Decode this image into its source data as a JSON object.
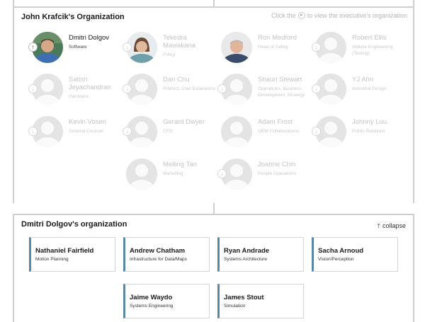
{
  "exec_panel": {
    "title": "John Krafcik's Organization",
    "hint_before": "Click the",
    "hint_after": "to view the executive's organization"
  },
  "executives": [
    {
      "name": "Dmitri Dolgov",
      "title": "Software",
      "active": true,
      "photo": "man-blue-shirt"
    },
    {
      "name": "Tekedra Mawakana",
      "title": "Policy",
      "active": false,
      "photo": "woman"
    },
    {
      "name": "Ron Medford",
      "title": "Head of Safety",
      "active": false,
      "photo": "man-gray-hair"
    },
    {
      "name": "Robert Ellis",
      "title": "Vehicle Engineering (Testing)",
      "active": false,
      "photo": "placeholder"
    },
    {
      "name": "Satish Jeyachandran",
      "title": "Hardware",
      "active": false,
      "photo": "placeholder"
    },
    {
      "name": "Dan Chu",
      "title": "Product, User Experience",
      "active": false,
      "photo": "placeholder"
    },
    {
      "name": "Shaun Stewart",
      "title": "Operations, Business Development, Strategy",
      "active": false,
      "photo": "placeholder"
    },
    {
      "name": "YJ Ahn",
      "title": "Industrial Design",
      "active": false,
      "photo": "placeholder"
    },
    {
      "name": "Kevin Vosen",
      "title": "General Counsel",
      "active": false,
      "photo": "placeholder"
    },
    {
      "name": "Gerard Dwyer",
      "title": "CFO",
      "active": false,
      "photo": "placeholder"
    },
    {
      "name": "Adam Frost",
      "title": "OEM Collaborations",
      "active": false,
      "photo": "placeholder"
    },
    {
      "name": "Johnny Luu",
      "title": "Public Relations",
      "active": false,
      "photo": "placeholder"
    },
    {
      "name": "Meiling Tan",
      "title": "Marketing",
      "active": false,
      "photo": "placeholder"
    },
    {
      "name": "Joanne Chin",
      "title": "People Operations",
      "active": false,
      "photo": "placeholder"
    }
  ],
  "org_panel": {
    "title": "Dmitri Dolgov's organization",
    "collapse_label": "collapse"
  },
  "reports": [
    {
      "name": "Nathaniel Fairfield",
      "title": "Motion Planning"
    },
    {
      "name": "Andrew Chatham",
      "title": "Infrastructure for Data/Maps"
    },
    {
      "name": "Ryan Andrade",
      "title": "Systems Architecture"
    },
    {
      "name": "Sacha Arnoud",
      "title": "Vision/Perception"
    },
    {
      "name": "Jaime Waydo",
      "title": "Systems Engineering"
    },
    {
      "name": "James Stout",
      "title": "Simulation"
    }
  ],
  "colors": {
    "accent": "#5a86a8",
    "muted": "#c4c4c4",
    "border": "#cfcfcf"
  }
}
